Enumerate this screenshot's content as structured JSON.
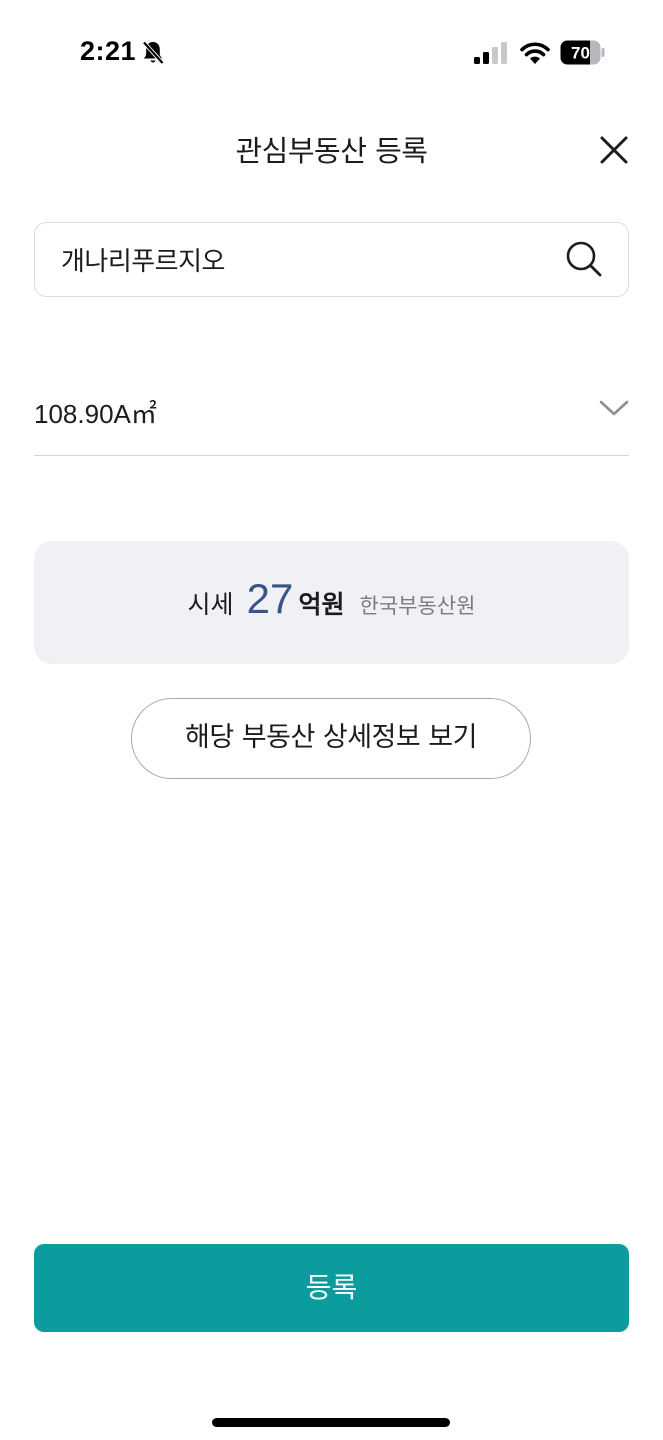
{
  "status_bar": {
    "time": "2:21",
    "battery_level": "70",
    "icons": [
      "bell-slash-icon",
      "cellular-signal-icon",
      "wifi-icon",
      "battery-icon"
    ]
  },
  "header": {
    "title": "관심부동산 등록",
    "close_icon": "close-icon"
  },
  "search": {
    "value": "개나리푸르지오",
    "placeholder": "",
    "icon": "search-icon"
  },
  "area_select": {
    "selected_value": "108.90A㎡",
    "icon": "chevron-down-icon"
  },
  "price_card": {
    "label": "시세",
    "value": "27",
    "unit": "억원",
    "source": "한국부동산원"
  },
  "detail_button": {
    "label": "해당 부동산 상세정보 보기"
  },
  "register_button": {
    "label": "등록"
  },
  "colors": {
    "accent": "#0c9c9e",
    "price_value": "#3a5488",
    "card_background": "#f0f1f5"
  }
}
